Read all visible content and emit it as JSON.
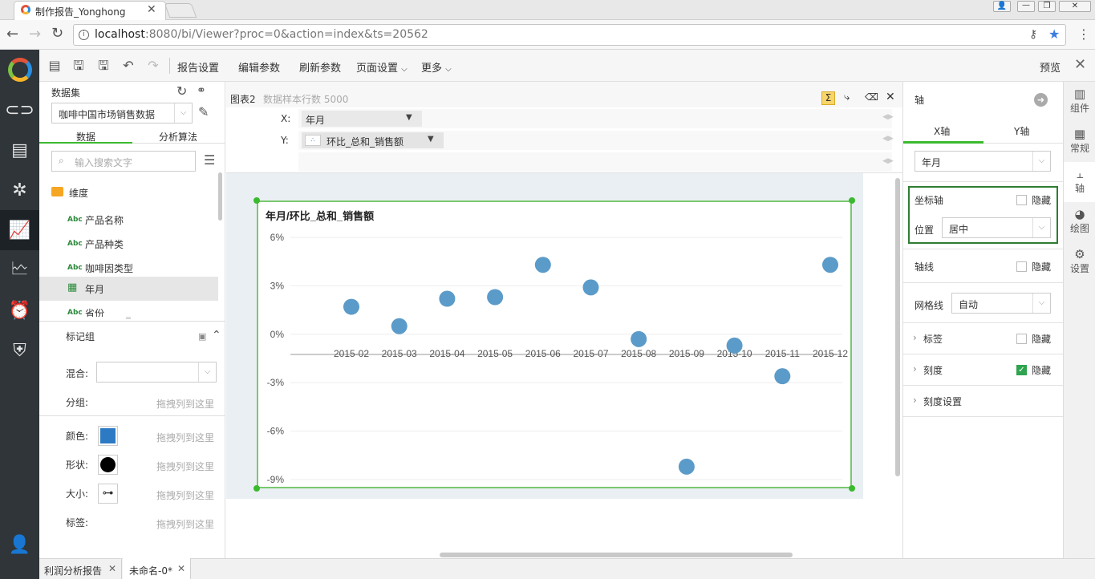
{
  "browser": {
    "tab_title": "制作报告_Yonghong",
    "url_host": "localhost",
    "url_rest": ":8080/bi/Viewer?proc=0&action=index&ts=20562"
  },
  "toolbar": {
    "report_settings": "报告设置",
    "edit_params": "编辑参数",
    "refresh_params": "刷新参数",
    "page_settings": "页面设置",
    "more": "更多",
    "preview": "预览"
  },
  "dataset": {
    "label": "数据集",
    "selected": "咖啡中国市场销售数据",
    "tab_data": "数据",
    "tab_algo": "分析算法",
    "search_placeholder": "输入搜索文字",
    "folder": "维度",
    "fields": [
      "产品名称",
      "产品种类",
      "咖啡因类型",
      "年月",
      "省份"
    ],
    "abc": "Abc"
  },
  "marks": {
    "title": "标记组",
    "mix_label": "混合:",
    "group_label": "分组:",
    "drop_hint": "拖拽列到这里",
    "color_label": "颜色:",
    "shape_label": "形状:",
    "size_label": "大小:",
    "tag_label": "标签:",
    "color_value": "#2d7ac4"
  },
  "chart_header": {
    "name": "图表2",
    "sample": "数据样本行数 5000",
    "x_label": "X:",
    "y_label": "Y:",
    "x_field": "年月",
    "y_field": "环比_总和_销售额"
  },
  "chart_data": {
    "type": "scatter",
    "title": "年月/环比_总和_销售额",
    "categories": [
      "2015-02",
      "2015-03",
      "2015-04",
      "2015-05",
      "2015-06",
      "2015-07",
      "2015-08",
      "2015-09",
      "2015-10",
      "2015-11",
      "2015-12"
    ],
    "values": [
      1.7,
      0.5,
      2.2,
      2.3,
      4.3,
      2.9,
      -0.3,
      -8.2,
      -0.7,
      -2.6,
      4.3
    ],
    "y_ticks": [
      "6%",
      "3%",
      "0%",
      "-3%",
      "-6%",
      "-9%"
    ],
    "ylim": [
      -9,
      6
    ],
    "unit": "%",
    "point_color": "#5b9bc9",
    "grid": true
  },
  "axis_panel": {
    "title": "轴",
    "tab_x": "X轴",
    "tab_y": "Y轴",
    "field": "年月",
    "coord_axis": "坐标轴",
    "hide": "隐藏",
    "position_label": "位置",
    "position_value": "居中",
    "axis_line": "轴线",
    "grid_label": "网格线",
    "grid_value": "自动",
    "tag": "标签",
    "scale": "刻度",
    "scale_settings": "刻度设置"
  },
  "right_tabs": [
    "组件",
    "常规",
    "轴",
    "绘图",
    "设置"
  ],
  "bottom_tabs": [
    "利润分析报告",
    "未命名-0*"
  ]
}
